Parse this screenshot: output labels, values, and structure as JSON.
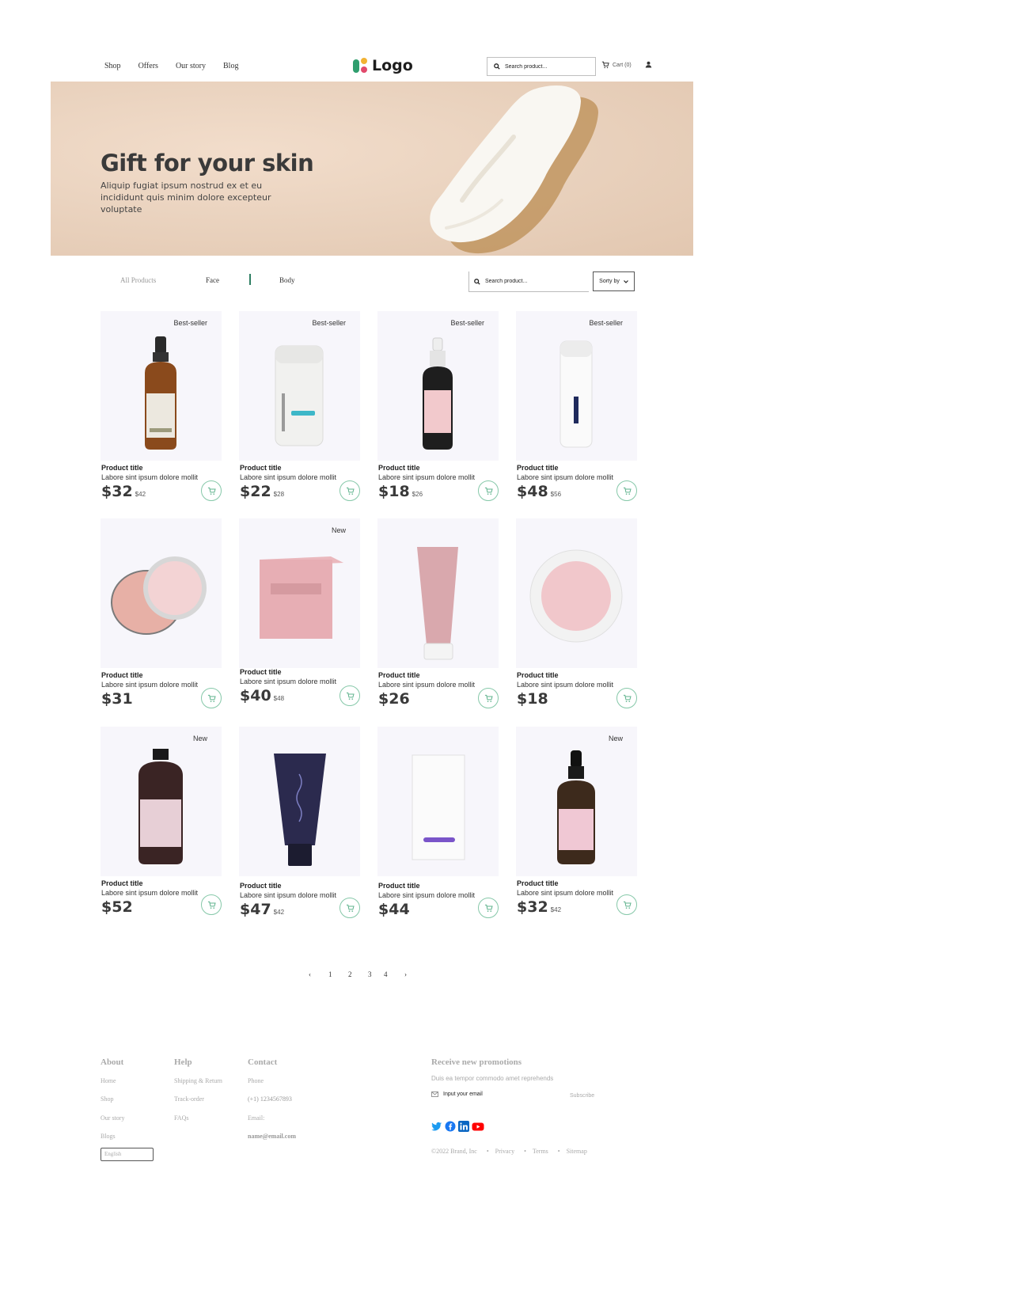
{
  "header": {
    "nav": [
      "Shop",
      "Offers",
      "Our story",
      "Blog"
    ],
    "logo_text": "Logo",
    "search_placeholder": "Search product...",
    "cart_label": "Cart (0)"
  },
  "hero": {
    "title": "Gift for your skin",
    "subtitle": "Aliquip fugiat ipsum nostrud ex et eu incididunt quis minim dolore excepteur voluptate"
  },
  "filters": {
    "tabs": [
      "All Products",
      "Face",
      "Body"
    ],
    "search_placeholder": "Search product...",
    "sort_label": "Sorty by"
  },
  "products": [
    {
      "badge": "Best-seller",
      "title": "Product title",
      "desc": "Labore sint ipsum dolore mollit",
      "price": "$32",
      "old_price": "$42",
      "image": "dropper-bottle-amber"
    },
    {
      "badge": "Best-seller",
      "title": "Product title",
      "desc": "Labore sint ipsum dolore mollit",
      "price": "$22",
      "old_price": "$28",
      "image": "white-cream-jar"
    },
    {
      "badge": "Best-seller",
      "title": "Product title",
      "desc": "Labore sint ipsum dolore mollit",
      "price": "$18",
      "old_price": "$26",
      "image": "dropper-bottle-black"
    },
    {
      "badge": "Best-seller",
      "title": "Product title",
      "desc": "Labore sint ipsum dolore mollit",
      "price": "$48",
      "old_price": "$56",
      "image": "white-pump-bottle"
    },
    {
      "badge": "",
      "title": "Product title",
      "desc": "Labore sint ipsum dolore mollit",
      "price": "$31",
      "old_price": "",
      "image": "pink-tin-open"
    },
    {
      "badge": "New",
      "title": "Product title",
      "desc": "Labore sint ipsum dolore mollit",
      "price": "$40",
      "old_price": "$48",
      "image": "pink-box"
    },
    {
      "badge": "",
      "title": "Product title",
      "desc": "Labore sint ipsum dolore mollit",
      "price": "$26",
      "old_price": "",
      "image": "pink-tube"
    },
    {
      "badge": "",
      "title": "Product title",
      "desc": "Labore sint ipsum dolore mollit",
      "price": "$18",
      "old_price": "",
      "image": "pink-jar-top"
    },
    {
      "badge": "New",
      "title": "Product title",
      "desc": "Labore sint ipsum dolore mollit",
      "price": "$52",
      "old_price": "",
      "image": "conditioner-bottle"
    },
    {
      "badge": "",
      "title": "Product title",
      "desc": "Labore sint ipsum dolore mollit",
      "price": "$47",
      "old_price": "$42",
      "image": "dark-tube"
    },
    {
      "badge": "",
      "title": "Product title",
      "desc": "Labore sint ipsum dolore mollit",
      "price": "$44",
      "old_price": "",
      "image": "white-box"
    },
    {
      "badge": "New",
      "title": "Product title",
      "desc": "Labore sint ipsum dolore mollit",
      "price": "$32",
      "old_price": "$42",
      "image": "serum-bottle"
    }
  ],
  "pagination": {
    "pages": [
      "1",
      "2",
      "3",
      "4"
    ],
    "prev": "‹",
    "next": "›"
  },
  "footer": {
    "about": {
      "title": "About",
      "links": [
        "Home",
        "Shop",
        "Our story",
        "Blogs"
      ]
    },
    "help": {
      "title": "Help",
      "links": [
        "Shipping & Return",
        "Track-order",
        "FAQs"
      ]
    },
    "contact": {
      "title": "Contact",
      "phone_label": "Phone",
      "phone": "(+1) 1234567893",
      "email_label": "Email:",
      "email": "name@email.com"
    },
    "language": "English",
    "promo": {
      "title": "Receive new promotions",
      "subtitle": "Duis ea tempor commodo amet reprehends",
      "email_placeholder": "Input your email",
      "subscribe": "Subscribe"
    },
    "socials": [
      "twitter-icon",
      "facebook-icon",
      "linkedin-icon",
      "youtube-icon"
    ],
    "legal": {
      "copyright": "©2022 Brand, Inc",
      "links": [
        "Privacy",
        "Terms",
        "Sitemap"
      ]
    }
  },
  "colors": {
    "accent": "#2f7f63",
    "cart_ring": "#86c8a9",
    "hero_bg": "#ead3bf"
  }
}
